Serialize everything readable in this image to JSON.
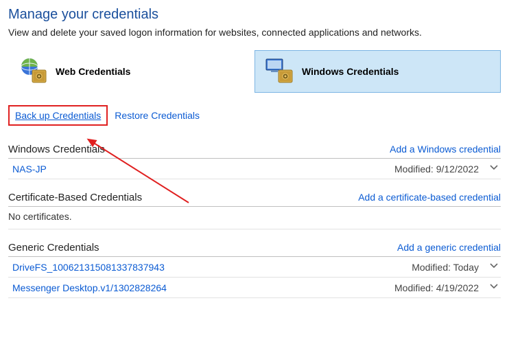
{
  "page": {
    "title": "Manage your credentials",
    "subtitle": "View and delete your saved logon information for websites, connected applications and networks."
  },
  "tabs": {
    "web": "Web Credentials",
    "windows": "Windows Credentials"
  },
  "links": {
    "backup": "Back up Credentials",
    "restore": "Restore Credentials"
  },
  "sections": {
    "windows": {
      "title": "Windows Credentials",
      "add": "Add a Windows credential",
      "items": [
        {
          "name": "NAS-JP",
          "modified": "Modified: 9/12/2022"
        }
      ]
    },
    "cert": {
      "title": "Certificate-Based Credentials",
      "add": "Add a certificate-based credential",
      "empty": "No certificates."
    },
    "generic": {
      "title": "Generic Credentials",
      "add": "Add a generic credential",
      "items": [
        {
          "name": "DriveFS_100621315081337837943",
          "modified": "Modified: Today"
        },
        {
          "name": "Messenger Desktop.v1/1302828264",
          "modified": "Modified: 4/19/2022"
        }
      ]
    }
  }
}
